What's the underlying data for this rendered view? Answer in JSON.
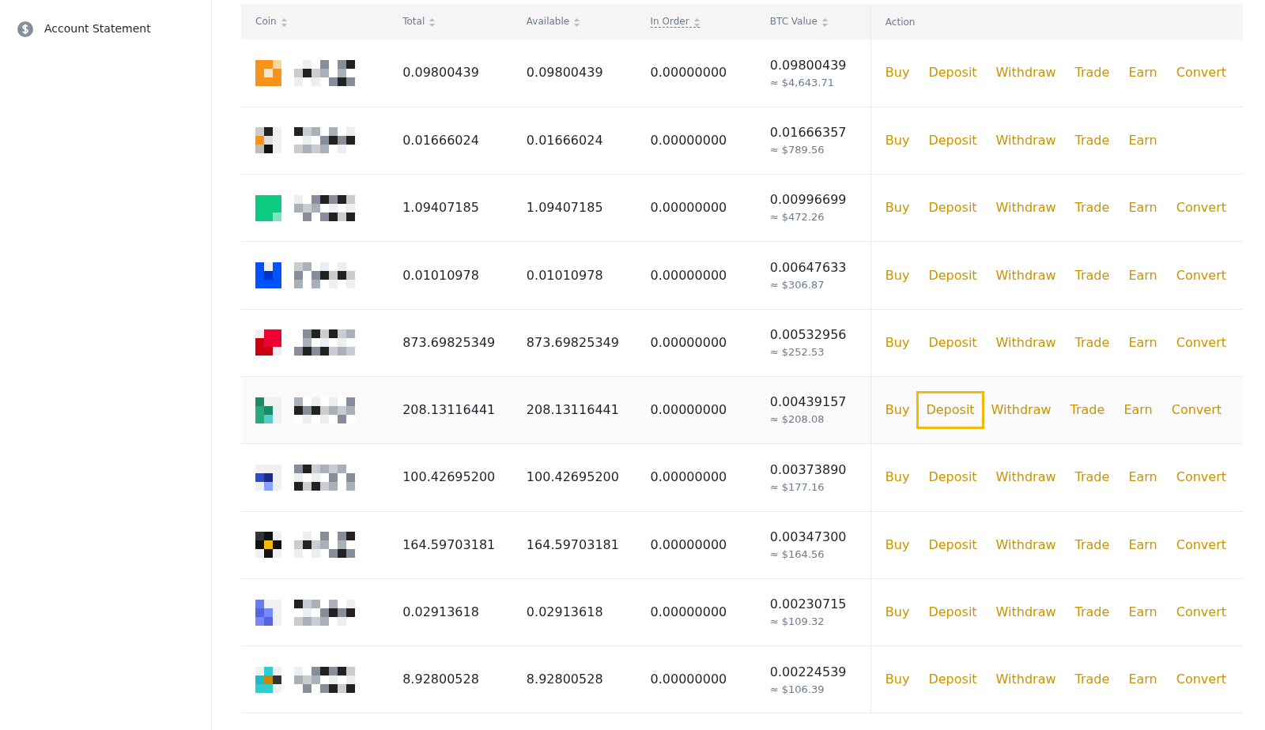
{
  "sidebar": {
    "items": [
      {
        "label": "Account Statement"
      }
    ]
  },
  "table": {
    "columns": [
      {
        "label": "Coin",
        "sortable": true,
        "underlined": false
      },
      {
        "label": "Total",
        "sortable": true,
        "underlined": false
      },
      {
        "label": "Available",
        "sortable": true,
        "underlined": false
      },
      {
        "label": "In Order",
        "sortable": true,
        "underlined": true
      },
      {
        "label": "BTC Value",
        "sortable": true,
        "underlined": false
      },
      {
        "label": "Action",
        "sortable": false,
        "underlined": false
      }
    ],
    "rows": [
      {
        "hovered": false,
        "total": "0.09800439",
        "available": "0.09800439",
        "in_order": "0.00000000",
        "btc": "0.09800439",
        "usd": "≈ $4,643.71",
        "actions": [
          {
            "label": "Buy",
            "highlighted": false
          },
          {
            "label": "Deposit",
            "highlighted": false
          },
          {
            "label": "Withdraw",
            "highlighted": false
          },
          {
            "label": "Trade",
            "highlighted": false
          },
          {
            "label": "Earn",
            "highlighted": false
          },
          {
            "label": "Convert",
            "highlighted": false
          }
        ]
      },
      {
        "hovered": false,
        "total": "0.01666024",
        "available": "0.01666024",
        "in_order": "0.00000000",
        "btc": "0.01666357",
        "usd": "≈ $789.56",
        "actions": [
          {
            "label": "Buy",
            "highlighted": false
          },
          {
            "label": "Deposit",
            "highlighted": false
          },
          {
            "label": "Withdraw",
            "highlighted": false
          },
          {
            "label": "Trade",
            "highlighted": false
          },
          {
            "label": "Earn",
            "highlighted": false
          }
        ]
      },
      {
        "hovered": false,
        "total": "1.09407185",
        "available": "1.09407185",
        "in_order": "0.00000000",
        "btc": "0.00996699",
        "usd": "≈ $472.26",
        "actions": [
          {
            "label": "Buy",
            "highlighted": false
          },
          {
            "label": "Deposit",
            "highlighted": false
          },
          {
            "label": "Withdraw",
            "highlighted": false
          },
          {
            "label": "Trade",
            "highlighted": false
          },
          {
            "label": "Earn",
            "highlighted": false
          },
          {
            "label": "Convert",
            "highlighted": false
          }
        ]
      },
      {
        "hovered": false,
        "total": "0.01010978",
        "available": "0.01010978",
        "in_order": "0.00000000",
        "btc": "0.00647633",
        "usd": "≈ $306.87",
        "actions": [
          {
            "label": "Buy",
            "highlighted": false
          },
          {
            "label": "Deposit",
            "highlighted": false
          },
          {
            "label": "Withdraw",
            "highlighted": false
          },
          {
            "label": "Trade",
            "highlighted": false
          },
          {
            "label": "Earn",
            "highlighted": false
          },
          {
            "label": "Convert",
            "highlighted": false
          }
        ]
      },
      {
        "hovered": false,
        "total": "873.69825349",
        "available": "873.69825349",
        "in_order": "0.00000000",
        "btc": "0.00532956",
        "usd": "≈ $252.53",
        "actions": [
          {
            "label": "Buy",
            "highlighted": false
          },
          {
            "label": "Deposit",
            "highlighted": false
          },
          {
            "label": "Withdraw",
            "highlighted": false
          },
          {
            "label": "Trade",
            "highlighted": false
          },
          {
            "label": "Earn",
            "highlighted": false
          },
          {
            "label": "Convert",
            "highlighted": false
          }
        ]
      },
      {
        "hovered": true,
        "total": "208.13116441",
        "available": "208.13116441",
        "in_order": "0.00000000",
        "btc": "0.00439157",
        "usd": "≈ $208.08",
        "actions": [
          {
            "label": "Buy",
            "highlighted": false
          },
          {
            "label": "Deposit",
            "highlighted": true
          },
          {
            "label": "Withdraw",
            "highlighted": false
          },
          {
            "label": "Trade",
            "highlighted": false
          },
          {
            "label": "Earn",
            "highlighted": false
          },
          {
            "label": "Convert",
            "highlighted": false
          }
        ]
      },
      {
        "hovered": false,
        "total": "100.42695200",
        "available": "100.42695200",
        "in_order": "0.00000000",
        "btc": "0.00373890",
        "usd": "≈ $177.16",
        "actions": [
          {
            "label": "Buy",
            "highlighted": false
          },
          {
            "label": "Deposit",
            "highlighted": false
          },
          {
            "label": "Withdraw",
            "highlighted": false
          },
          {
            "label": "Trade",
            "highlighted": false
          },
          {
            "label": "Earn",
            "highlighted": false
          },
          {
            "label": "Convert",
            "highlighted": false
          }
        ]
      },
      {
        "hovered": false,
        "total": "164.59703181",
        "available": "164.59703181",
        "in_order": "0.00000000",
        "btc": "0.00347300",
        "usd": "≈ $164.56",
        "actions": [
          {
            "label": "Buy",
            "highlighted": false
          },
          {
            "label": "Deposit",
            "highlighted": false
          },
          {
            "label": "Withdraw",
            "highlighted": false
          },
          {
            "label": "Trade",
            "highlighted": false
          },
          {
            "label": "Earn",
            "highlighted": false
          },
          {
            "label": "Convert",
            "highlighted": false
          }
        ]
      },
      {
        "hovered": false,
        "total": "0.02913618",
        "available": "0.02913618",
        "in_order": "0.00000000",
        "btc": "0.00230715",
        "usd": "≈ $109.32",
        "actions": [
          {
            "label": "Buy",
            "highlighted": false
          },
          {
            "label": "Deposit",
            "highlighted": false
          },
          {
            "label": "Withdraw",
            "highlighted": false
          },
          {
            "label": "Trade",
            "highlighted": false
          },
          {
            "label": "Earn",
            "highlighted": false
          },
          {
            "label": "Convert",
            "highlighted": false
          }
        ]
      },
      {
        "hovered": false,
        "total": "8.92800528",
        "available": "8.92800528",
        "in_order": "0.00000000",
        "btc": "0.00224539",
        "usd": "≈ $106.39",
        "actions": [
          {
            "label": "Buy",
            "highlighted": false
          },
          {
            "label": "Deposit",
            "highlighted": false
          },
          {
            "label": "Withdraw",
            "highlighted": false
          },
          {
            "label": "Trade",
            "highlighted": false
          },
          {
            "label": "Earn",
            "highlighted": false
          },
          {
            "label": "Convert",
            "highlighted": false
          }
        ]
      }
    ]
  }
}
